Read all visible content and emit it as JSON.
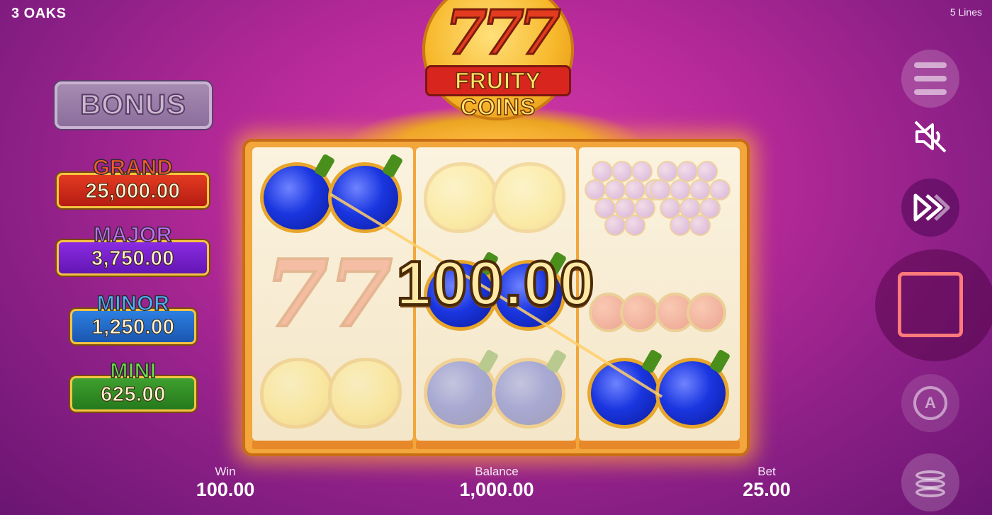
{
  "header": {
    "provider": "3 OAKS",
    "lines": "5 Lines"
  },
  "logo": {
    "sevens": "777",
    "line1": "FRUITY",
    "line2": "COINS"
  },
  "bonus": {
    "label": "BONUS"
  },
  "jackpots": [
    {
      "name": "GRAND",
      "value": "25,000.00"
    },
    {
      "name": "MAJOR",
      "value": "3,750.00"
    },
    {
      "name": "MINOR",
      "value": "1,250.00"
    },
    {
      "name": "MINI",
      "value": "625.00"
    }
  ],
  "reels": [
    [
      "plum",
      "seven",
      "lemon"
    ],
    [
      "lemon",
      "plum",
      "plum"
    ],
    [
      "grape",
      "cherry",
      "plum"
    ]
  ],
  "win_overlay": "100.00",
  "controls": {
    "menu": "menu-icon",
    "sound": "speaker-muted-icon",
    "turbo": "fast-forward-icon",
    "spin": "stop-icon",
    "autoplay_letter": "A",
    "bet": "coin-stack-icon"
  },
  "stats": {
    "win_label": "Win",
    "win_value": "100.00",
    "balance_label": "Balance",
    "balance_value": "1,000.00",
    "bet_label": "Bet",
    "bet_value": "25.00"
  },
  "colors": {
    "background": "#b92a9a",
    "frame": "#f2a63b",
    "stop_outline": "#ff7a7a"
  }
}
